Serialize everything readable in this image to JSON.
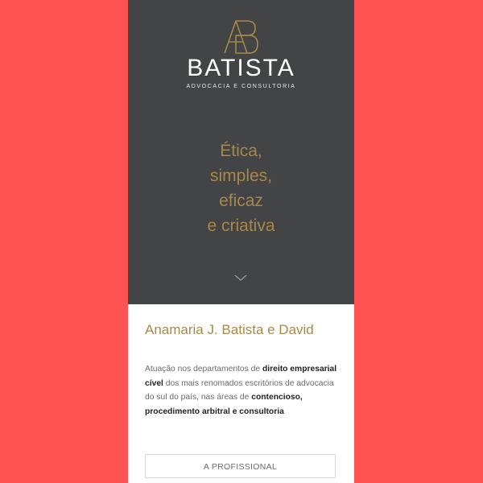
{
  "brand": {
    "name": "BATISTA",
    "tagline": "ADVOCACIA E CONSULTORIA",
    "logo_icon": "ab-monogram-logo-icon",
    "gold_color": "#a8884a"
  },
  "hero": {
    "motto_lines": [
      "Ética,",
      "simples,",
      "eficaz",
      "e criativa"
    ],
    "background_color": "#434446",
    "scroll_icon": "chevron-down-icon"
  },
  "profile": {
    "name": "Anamaria J. Batista e David",
    "bio_segments": [
      {
        "text": "Atuação nos departamentos de ",
        "bold": false
      },
      {
        "text": "direito empresarial cível",
        "bold": true
      },
      {
        "text": " dos mais renomados escritórios de advocacia do sul do país, nas áreas de ",
        "bold": false
      },
      {
        "text": "contencioso, procedimento arbitral e consultoria",
        "bold": true
      }
    ],
    "button_label": "A PROFISSIONAL"
  },
  "page": {
    "outer_background": "#ff5252"
  }
}
